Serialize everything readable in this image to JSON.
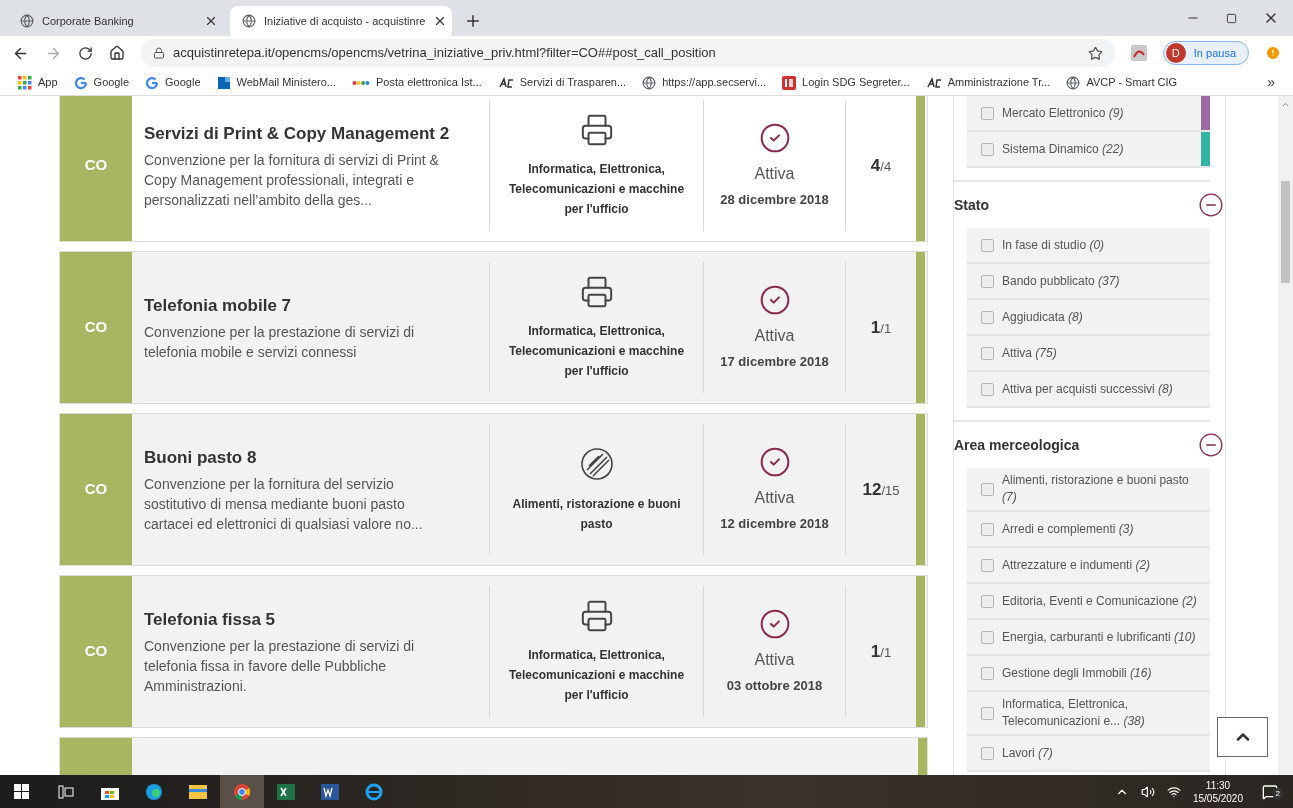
{
  "browser": {
    "tabs": [
      {
        "title": "Corporate Banking",
        "selected": false
      },
      {
        "title": "Iniziative di acquisto - acquistinre",
        "selected": true
      }
    ],
    "url": "acquistinretepa.it/opencms/opencms/vetrina_iniziative_priv.html?filter=CO##post_call_position",
    "profile": {
      "initial": "D",
      "status": "In pausa"
    },
    "bookmarks": [
      {
        "label": "App",
        "kind": "apps"
      },
      {
        "label": "Google",
        "kind": "google"
      },
      {
        "label": "Google",
        "kind": "google"
      },
      {
        "label": "WebMail Ministero...",
        "kind": "mail"
      },
      {
        "label": "Posta elettronica Ist...",
        "kind": "dots"
      },
      {
        "label": "Servizi di Trasparen...",
        "kind": "ga"
      },
      {
        "label": "https://app.secservi...",
        "kind": "globe"
      },
      {
        "label": "Login SDG Segreter...",
        "kind": "is"
      },
      {
        "label": "Amministrazione Tr...",
        "kind": "ga"
      },
      {
        "label": "AVCP - Smart CIG",
        "kind": "globe"
      }
    ],
    "more": "»"
  },
  "initiatives": [
    {
      "badge": "CO",
      "title": "Servizi di Print & Copy Management 2",
      "description": "Convenzione per la fornitura di servizi di Print & Copy Management professionali, integrati e personalizzati nell’ambito della ges...",
      "category": "Informatica, Elettronica, Telecomunicazioni e macchine per l'ufficio",
      "kind": "printer",
      "status": "Attiva",
      "date": "28 dicembre 2018",
      "count": "**4**/4",
      "highlighted": true
    },
    {
      "badge": "CO",
      "title": "Telefonia mobile 7",
      "description": "Convenzione per la prestazione di servizi di telefonia mobile e servizi connessi",
      "category": "Informatica, Elettronica, Telecomunicazioni e macchine per l'ufficio",
      "kind": "printer",
      "status": "Attiva",
      "date": "17 dicembre 2018",
      "count": "**1**/1",
      "highlighted": false
    },
    {
      "badge": "CO",
      "title": "Buoni pasto 8",
      "description": "Convenzione per la fornitura del servizio sostitutivo di mensa mediante buoni pasto cartacei ed elettronici di qualsiasi valore no...",
      "category": "Alimenti, ristorazione e buoni pasto",
      "kind": "food",
      "status": "Attiva",
      "date": "12 dicembre 2018",
      "count": "**12**/15",
      "highlighted": false
    },
    {
      "badge": "CO",
      "title": "Telefonia fissa 5",
      "description": "Convenzione per la prestazione di servizi di telefonia fissa in favore delle Pubbliche Amministrazioni.",
      "category": "Informatica, Elettronica, Telecomunicazioni e macchine per l'ufficio",
      "kind": "printer",
      "status": "Attiva",
      "date": "03 ottobre 2018",
      "count": "**1**/1",
      "highlighted": false
    }
  ],
  "filters": {
    "types": [
      {
        "label": "Mercato Elettronico",
        "count": "(9)",
        "checked": false,
        "color": "#9a6aa4"
      },
      {
        "label": "Sistema Dinamico",
        "count": "(22)",
        "checked": false,
        "color": "#2fb3a4"
      }
    ],
    "sections": [
      {
        "title": "Stato",
        "expanded": true,
        "items": [
          {
            "label": "In fase di studio",
            "count": "(0)",
            "checked": false
          },
          {
            "label": "Bando pubblicato",
            "count": "(37)",
            "checked": false
          },
          {
            "label": "Aggiudicata",
            "count": "(8)",
            "checked": false
          },
          {
            "label": "Attiva",
            "count": "(75)",
            "checked": false
          },
          {
            "label": "Attiva per acquisti successivi",
            "count": "(8)",
            "checked": false
          }
        ]
      },
      {
        "title": "Area merceologica",
        "expanded": true,
        "items": [
          {
            "label": "Alimenti, ristorazione e buoni pasto",
            "count": "(7)",
            "checked": false
          },
          {
            "label": "Arredi e complementi",
            "count": "(3)",
            "checked": false
          },
          {
            "label": "Attrezzature e indumenti",
            "count": "(2)",
            "checked": false
          },
          {
            "label": "Editoria, Eventi e Comunicazione",
            "count": "(2)",
            "checked": false
          },
          {
            "label": "Energia, carburanti e lubrificanti",
            "count": "(10)",
            "checked": false
          },
          {
            "label": "Gestione degli Immobili",
            "count": "(16)",
            "checked": false
          },
          {
            "label": "Informatica, Elettronica, Telecomunicazioni e...",
            "count": "(38)",
            "checked": false
          },
          {
            "label": "Lavori",
            "count": "(7)",
            "checked": false
          }
        ]
      }
    ]
  },
  "taskbar": {
    "time": "11:30",
    "date": "15/05/2020",
    "notifications": "2"
  }
}
